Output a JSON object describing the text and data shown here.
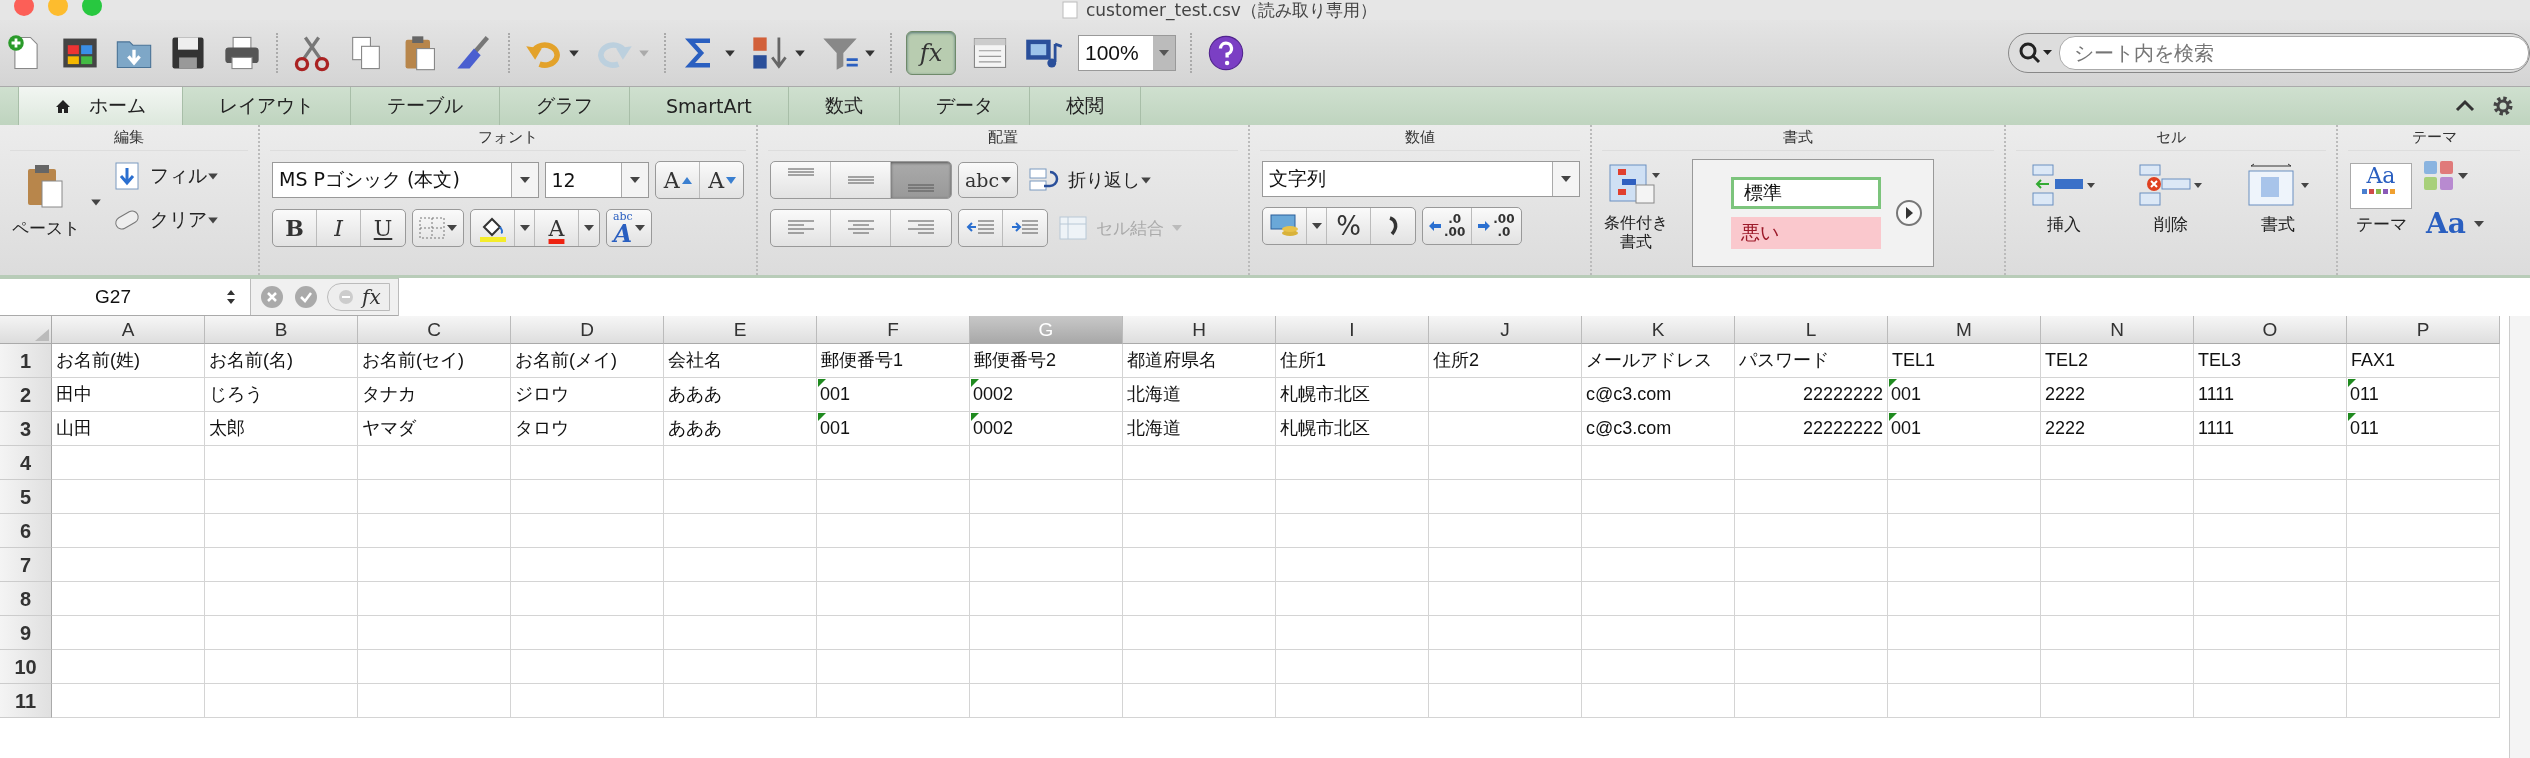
{
  "window": {
    "title": "customer_test.csv（読み取り専用）"
  },
  "toolbar": {
    "formula_button": {
      "label": "fx",
      "on": true
    },
    "zoom": "100%",
    "search": {
      "placeholder": "シート内を検索"
    }
  },
  "tabs": [
    {
      "label": "ホーム",
      "selected": true
    },
    {
      "label": "レイアウト",
      "selected": false
    },
    {
      "label": "テーブル",
      "selected": false
    },
    {
      "label": "グラフ",
      "selected": false
    },
    {
      "label": "SmartArt",
      "selected": false
    },
    {
      "label": "数式",
      "selected": false
    },
    {
      "label": "データ",
      "selected": false
    },
    {
      "label": "校閲",
      "selected": false
    }
  ],
  "ribbon": {
    "edit": {
      "title": "編集",
      "paste": "ペースト",
      "fill": "フィル",
      "clear": "クリア"
    },
    "font": {
      "title": "フォント",
      "font_name": "MS Pゴシック (本文)",
      "font_size": "12",
      "grow": "A",
      "shrink": "A",
      "bold": "B",
      "italic": "I",
      "underline": "U",
      "font_color": "A",
      "text_styles": {
        "small": "abc",
        "large": "A"
      }
    },
    "alignment": {
      "title": "配置",
      "vertical": [
        {
          "selected": false
        },
        {
          "selected": false
        },
        {
          "selected": true
        }
      ],
      "orientation": "abc",
      "wrap": "折り返し",
      "merge": {
        "label": "セル結合",
        "disabled": true
      }
    },
    "number": {
      "title": "数値",
      "format": "文字列",
      "percent": "%",
      "increase_decimal": {
        "top": ".0",
        "bottom": ".00"
      },
      "decrease_decimal": {
        "top": ".00",
        "bottom": ".0"
      }
    },
    "styles": {
      "title": "書式",
      "conditional_format": [
        "条件付き",
        "書式"
      ],
      "cell_styles": [
        {
          "label": "標準",
          "kind": "normal"
        },
        {
          "label": "悪い",
          "kind": "bad"
        }
      ]
    },
    "cells": {
      "title": "セル",
      "insert": "挿入",
      "delete": "削除",
      "format": "書式"
    },
    "themes": {
      "title": "テーマ",
      "themes": "テーマ",
      "theme_preview": "Aa",
      "fonts": "Aa"
    }
  },
  "formula_bar": {
    "cell_ref": "G27",
    "fx": "fx"
  },
  "sheet": {
    "columns": [
      {
        "letter": "A",
        "selected": false
      },
      {
        "letter": "B",
        "selected": false
      },
      {
        "letter": "C",
        "selected": false
      },
      {
        "letter": "D",
        "selected": false
      },
      {
        "letter": "E",
        "selected": false
      },
      {
        "letter": "F",
        "selected": false
      },
      {
        "letter": "G",
        "selected": true
      },
      {
        "letter": "H",
        "selected": false
      },
      {
        "letter": "I",
        "selected": false
      },
      {
        "letter": "J",
        "selected": false
      },
      {
        "letter": "K",
        "selected": false
      },
      {
        "letter": "L",
        "selected": false
      },
      {
        "letter": "M",
        "selected": false
      },
      {
        "letter": "N",
        "selected": false
      },
      {
        "letter": "O",
        "selected": false
      },
      {
        "letter": "P",
        "selected": false
      }
    ],
    "rows": [
      {
        "number": "1",
        "cells": [
          {
            "kind": "text",
            "text": "お名前(姓)"
          },
          {
            "kind": "text",
            "text": "お名前(名)"
          },
          {
            "kind": "text",
            "text": "お名前(セイ)"
          },
          {
            "kind": "text",
            "text": "お名前(メイ)"
          },
          {
            "kind": "text",
            "text": "会社名"
          },
          {
            "kind": "text",
            "text": "郵便番号1"
          },
          {
            "kind": "text",
            "text": "郵便番号2"
          },
          {
            "kind": "text",
            "text": "都道府県名"
          },
          {
            "kind": "text",
            "text": "住所1"
          },
          {
            "kind": "text",
            "text": "住所2"
          },
          {
            "kind": "text",
            "text": "メールアドレス"
          },
          {
            "kind": "text",
            "text": "パスワード"
          },
          {
            "kind": "text",
            "text": "TEL1"
          },
          {
            "kind": "text",
            "text": "TEL2"
          },
          {
            "kind": "text",
            "text": "TEL3"
          },
          {
            "kind": "text",
            "text": "FAX1"
          }
        ]
      },
      {
        "number": "2",
        "cells": [
          {
            "kind": "text",
            "text": "田中"
          },
          {
            "kind": "text",
            "text": "じろう"
          },
          {
            "kind": "text",
            "text": "タナカ"
          },
          {
            "kind": "text",
            "text": "ジロウ"
          },
          {
            "kind": "text",
            "text": "あああ"
          },
          {
            "kind": "numeric_text",
            "text": "001"
          },
          {
            "kind": "numeric_text",
            "text": "0002"
          },
          {
            "kind": "text",
            "text": "北海道"
          },
          {
            "kind": "text",
            "text": "札幌市北区"
          },
          {
            "kind": "blank"
          },
          {
            "kind": "text",
            "text": "c@c3.com"
          },
          {
            "kind": "number",
            "text": "22222222"
          },
          {
            "kind": "numeric_text",
            "text": "001"
          },
          {
            "kind": "text",
            "text": "2222"
          },
          {
            "kind": "text",
            "text": "1111"
          },
          {
            "kind": "numeric_text",
            "text": "011"
          }
        ]
      },
      {
        "number": "3",
        "cells": [
          {
            "kind": "text",
            "text": "山田"
          },
          {
            "kind": "text",
            "text": "太郎"
          },
          {
            "kind": "text",
            "text": "ヤマダ"
          },
          {
            "kind": "text",
            "text": "タロウ"
          },
          {
            "kind": "text",
            "text": "あああ"
          },
          {
            "kind": "numeric_text",
            "text": "001"
          },
          {
            "kind": "numeric_text",
            "text": "0002"
          },
          {
            "kind": "text",
            "text": "北海道"
          },
          {
            "kind": "text",
            "text": "札幌市北区"
          },
          {
            "kind": "blank"
          },
          {
            "kind": "text",
            "text": "c@c3.com"
          },
          {
            "kind": "number",
            "text": "22222222"
          },
          {
            "kind": "numeric_text",
            "text": "001"
          },
          {
            "kind": "text",
            "text": "2222"
          },
          {
            "kind": "text",
            "text": "1111"
          },
          {
            "kind": "numeric_text",
            "text": "011"
          }
        ]
      },
      {
        "number": "4"
      },
      {
        "number": "5"
      },
      {
        "number": "6"
      },
      {
        "number": "7"
      },
      {
        "number": "8"
      },
      {
        "number": "9"
      },
      {
        "number": "10"
      },
      {
        "number": "11"
      }
    ]
  }
}
